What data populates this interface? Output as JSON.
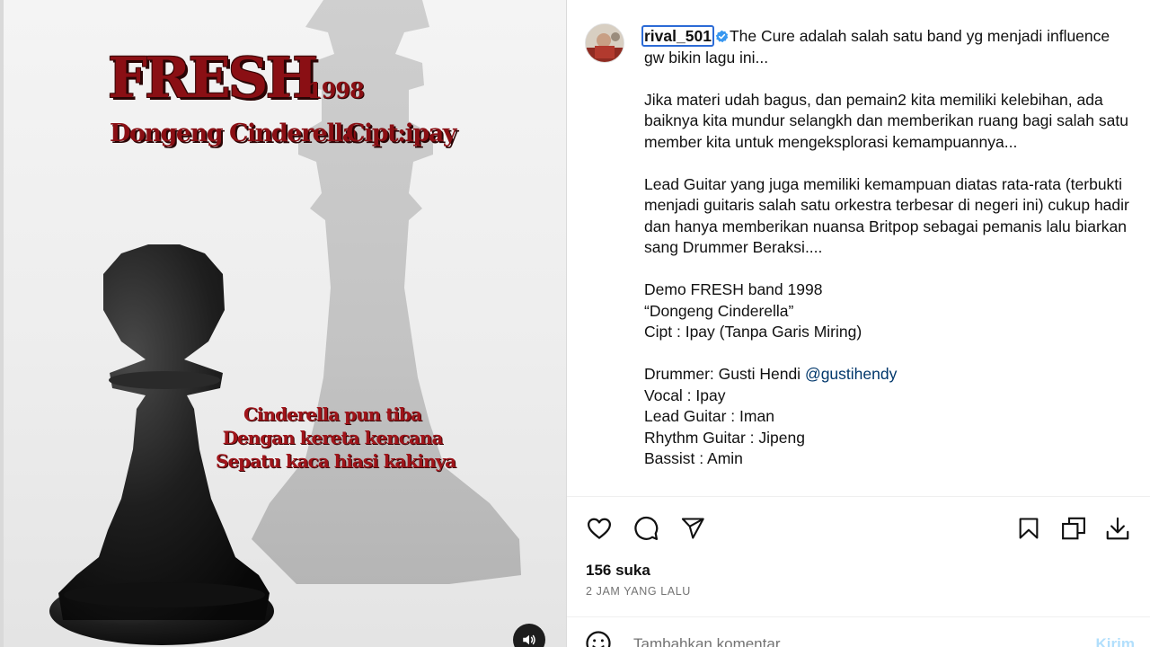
{
  "media": {
    "title": "FRESH",
    "year": "1998",
    "song_title": "Dongeng Cinderella",
    "credit": "Cipt:ipay",
    "lyrics": [
      "Cinderella pun tiba",
      "Dengan kereta kencana",
      "Sepatu kaca hiasi kakinya"
    ],
    "audio_icon": "speaker-icon"
  },
  "post": {
    "username": "rival_501",
    "verified_icon": "verified-badge-icon",
    "caption_first": "The Cure adalah salah satu band yg menjadi influence gw bikin lagu ini...",
    "paragraph_2": "Jika materi udah bagus, dan pemain2 kita memiliki kelebihan, ada baiknya kita mundur selangkh dan memberikan ruang bagi salah satu member kita untuk mengeksplorasi kemampuannya...",
    "paragraph_3": "Lead Guitar yang juga memiliki kemampuan diatas rata-rata (terbukti menjadi guitaris salah satu orkestra terbesar di negeri ini) cukup hadir dan hanya memberikan nuansa Britpop sebagai pemanis lalu biarkan sang Drummer Beraksi....",
    "demo_line": "Demo FRESH band 1998",
    "song_line": "“Dongeng Cinderella”",
    "cipt_line": "Cipt : Ipay (Tanpa Garis Miring)",
    "drummer_label": "Drummer: Gusti Hendi ",
    "drummer_mention": "@gustihendy",
    "vocal_line": "Vocal : Ipay",
    "lead_line": "Lead Guitar : Iman",
    "rhythm_line": "Rhythm Guitar : Jipeng",
    "bassist_line": "Bassist : Amin"
  },
  "actions": {
    "icons": [
      "heart-icon",
      "comment-icon",
      "share-icon",
      "bookmark-icon",
      "collection-icon",
      "download-icon"
    ]
  },
  "stats": {
    "likes": "156 suka",
    "time": "2 JAM YANG LALU"
  },
  "comment": {
    "placeholder": "Tambahkan komentar...",
    "send_label": "Kirim",
    "emoji_icon": "emoji-icon"
  },
  "colors": {
    "title_red": "#8a0f14",
    "mention": "#00376b",
    "verified_blue": "#3897f0",
    "send_disabled": "#b2dffc"
  }
}
